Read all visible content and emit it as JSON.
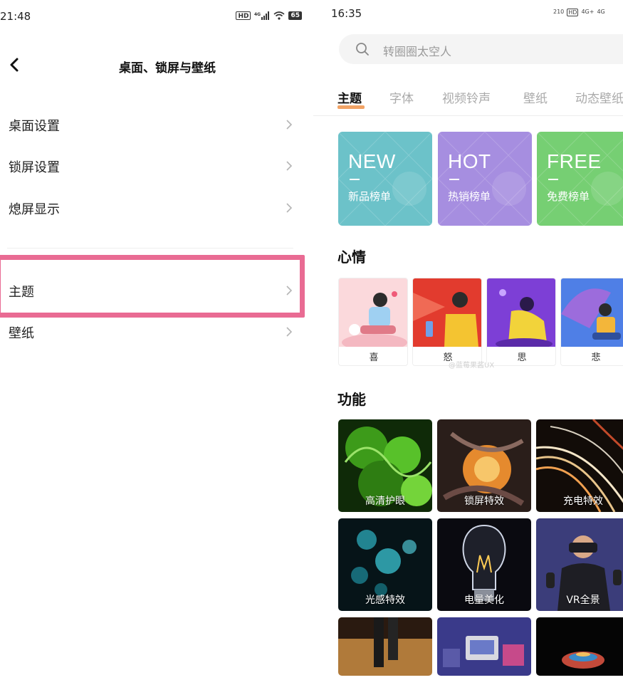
{
  "left": {
    "status": {
      "time": "21:48",
      "icons": [
        "HD",
        "4G",
        "wifi",
        "65"
      ]
    },
    "title": "桌面、锁屏与壁纸",
    "items": [
      {
        "label": "桌面设置"
      },
      {
        "label": "锁屏设置"
      },
      {
        "label": "熄屏显示"
      },
      {
        "label": "主题"
      },
      {
        "label": "壁纸"
      }
    ],
    "highlight_color": "#e96b93"
  },
  "right": {
    "status": {
      "time": "16:35",
      "icons": [
        "210",
        "HD",
        "4G+",
        "4G"
      ]
    },
    "search": {
      "placeholder": "转圈圈太空人"
    },
    "tabs": [
      {
        "label": "主题"
      },
      {
        "label": "字体"
      },
      {
        "label": "视频铃声"
      },
      {
        "label": "壁纸"
      },
      {
        "label": "动态壁纸"
      }
    ],
    "tab_accent": "#f2a365",
    "ranks": [
      {
        "big": "NEW",
        "small": "新品榜单",
        "color": "#6cc2c9"
      },
      {
        "big": "HOT",
        "small": "热销榜单",
        "color": "#a68ee0"
      },
      {
        "big": "FREE",
        "small": "免费榜单",
        "color": "#76cf73"
      }
    ],
    "mood_title": "心情",
    "moods": [
      {
        "label": "喜"
      },
      {
        "label": "怒"
      },
      {
        "label": "思"
      },
      {
        "label": "悲"
      }
    ],
    "watermark": "@蓝莓果酱UX",
    "feature_title": "功能",
    "features": [
      {
        "label": "高清护眼"
      },
      {
        "label": "锁屏特效"
      },
      {
        "label": "充电特效"
      },
      {
        "label": "光感特效"
      },
      {
        "label": "电量美化"
      },
      {
        "label": "VR全景"
      },
      {
        "label": ""
      },
      {
        "label": ""
      },
      {
        "label": ""
      }
    ]
  }
}
